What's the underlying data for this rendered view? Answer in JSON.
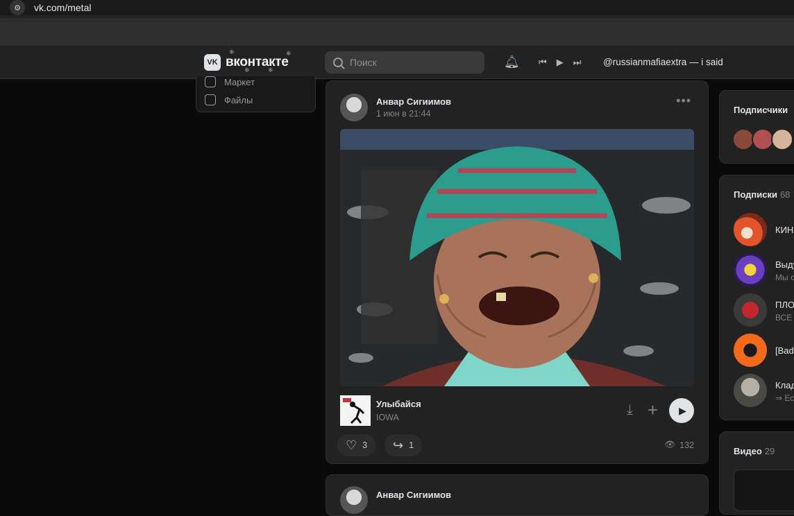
{
  "browser": {
    "url": "vk.com/metal"
  },
  "header": {
    "logo_mark": "VK",
    "logo_text": "вконтакте",
    "search_placeholder": "Поиск",
    "now_playing": "@russianmafiaextra — i said"
  },
  "left_menu": [
    {
      "label": "Маркет",
      "icon": "market-icon"
    },
    {
      "label": "Файлы",
      "icon": "file-icon"
    }
  ],
  "post": {
    "author": "Анвар Сигиимов",
    "date": "1 июн в 21:44",
    "audio": {
      "title": "Улыбайся",
      "artist": "IOWA"
    },
    "likes": "3",
    "shares": "1",
    "views": "132"
  },
  "next_post": {
    "author": "Анвар Сигиимов"
  },
  "sidebar": {
    "followers": {
      "title": "Подписчики"
    },
    "subscriptions": {
      "title": "Подписки",
      "count": "68",
      "items": [
        {
          "name": "КИН",
          "sub": ""
        },
        {
          "name": "Выду",
          "sub": "Мы с"
        },
        {
          "name": "ПЛО",
          "sub": "ВСЕ"
        },
        {
          "name": "[Bad",
          "sub": ""
        },
        {
          "name": "Клад",
          "sub": "⇒ Ес"
        }
      ]
    },
    "video": {
      "title": "Видео",
      "count": "29"
    }
  },
  "colors": {
    "accent": "#e1e3e6",
    "background": "#0a0a0a",
    "card": "#222222"
  }
}
